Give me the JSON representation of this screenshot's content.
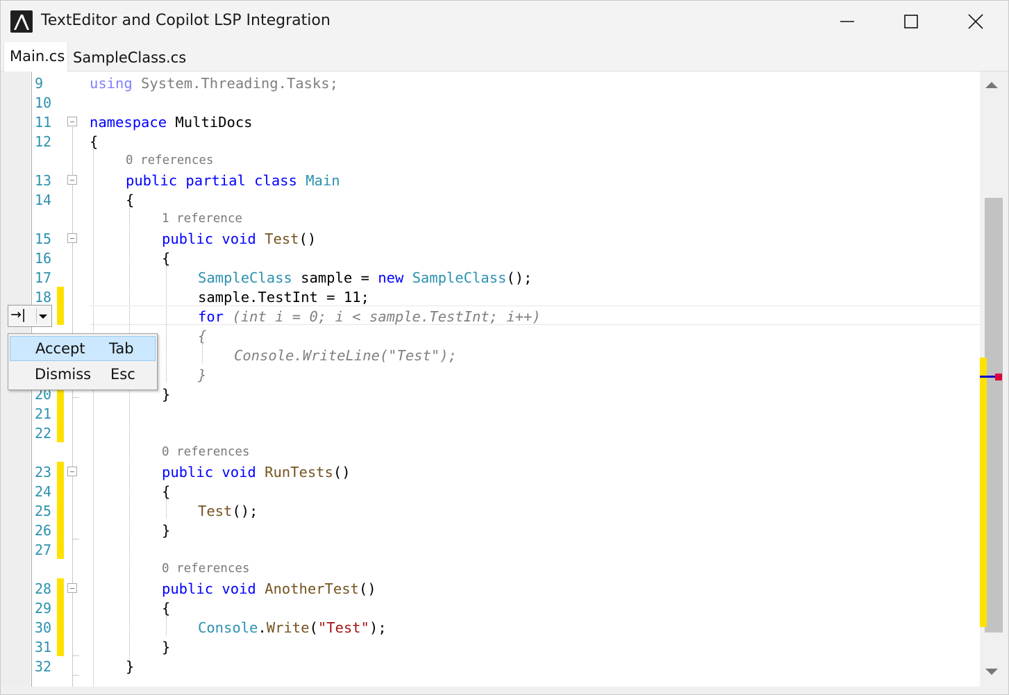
{
  "window": {
    "title": "TextEditor and Copilot LSP Integration"
  },
  "tabs": [
    {
      "label": "Main.cs",
      "active": true
    },
    {
      "label": "SampleClass.cs",
      "active": false
    }
  ],
  "editor": {
    "line_numbers": [
      "9",
      "10",
      "11",
      "12",
      "13",
      "14",
      "15",
      "16",
      "17",
      "18",
      "20",
      "21",
      "22",
      "23",
      "24",
      "25",
      "26",
      "27",
      "28",
      "29",
      "30",
      "31",
      "32"
    ],
    "code_lens": {
      "main_class": "0 references",
      "test": "1 reference",
      "run_tests": "0 references",
      "another_test": "0 references"
    },
    "code": {
      "l9_kw": "using",
      "l9_rest": " System.Threading.Tasks;",
      "l11_kw": "namespace",
      "l11_rest": " MultiDocs",
      "l12": "{",
      "l13_kw": "public partial class",
      "l13_sp": " ",
      "l13_ty": "Main",
      "l14": "{",
      "l15_kw": "public void",
      "l15_sp": " ",
      "l15_mt": "Test",
      "l15_rest": "()",
      "l16": "{",
      "l17_ty1": "SampleClass",
      "l17_a": " sample = ",
      "l17_kw": "new",
      "l17_sp": " ",
      "l17_ty2": "SampleClass",
      "l17_b": "();",
      "l18": "sample.TestInt = 11;",
      "l19_kw": "for",
      "l19_ghost": " (int i = 0; i < sample.TestInt; i++)",
      "ghost_open": "{",
      "ghost_body": "Console.WriteLine(\"Test\");",
      "ghost_close": "}",
      "l20": "}",
      "l23_kw": "public void",
      "l23_sp": " ",
      "l23_mt": "RunTests",
      "l23_rest": "()",
      "l24": "{",
      "l25_mt": "Test",
      "l25_rest": "();",
      "l26": "}",
      "l28_kw": "public void",
      "l28_sp": " ",
      "l28_mt": "AnotherTest",
      "l28_rest": "()",
      "l29": "{",
      "l30_ty": "Console",
      "l30_dot": ".",
      "l30_mt": "Write",
      "l30_a": "(",
      "l30_st": "\"Test\"",
      "l30_b": ");",
      "l31": "}",
      "l32": "}"
    }
  },
  "copilot": {
    "tab_hint_symbol": "→|",
    "menu": [
      {
        "label": "Accept",
        "shortcut": "Tab",
        "selected": true
      },
      {
        "label": "Dismiss",
        "shortcut": "Esc",
        "selected": false
      }
    ]
  },
  "colors": {
    "keyword": "#0000ff",
    "type": "#2b91af",
    "method": "#74531f",
    "string": "#a31515",
    "line_number": "#2b91af",
    "change_marker": "#ffe100",
    "ghost_text": "#808080"
  }
}
